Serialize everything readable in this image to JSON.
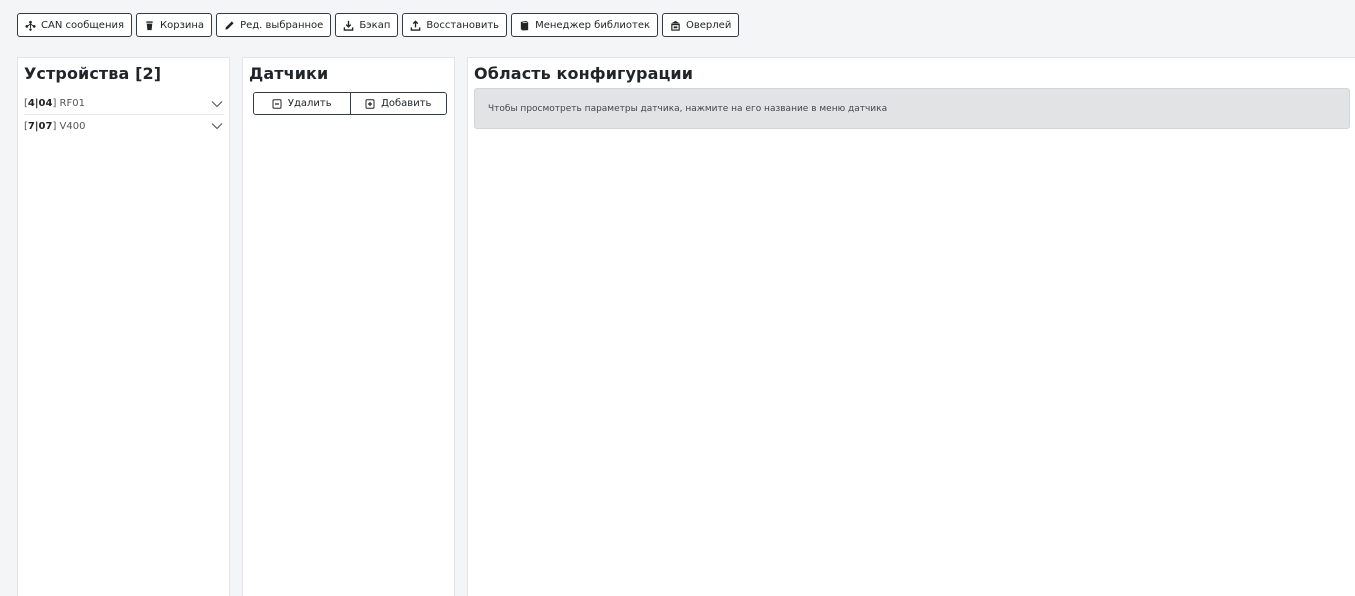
{
  "toolbar": {
    "buttons": [
      {
        "label": "CAN сообщения",
        "icon": "share-nodes-icon"
      },
      {
        "label": "Корзина",
        "icon": "trash-icon"
      },
      {
        "label": "Ред. выбранное",
        "icon": "pencil-icon"
      },
      {
        "label": "Бэкап",
        "icon": "download-icon"
      },
      {
        "label": "Восстановить",
        "icon": "upload-icon"
      },
      {
        "label": "Менеджер библиотек",
        "icon": "book-icon"
      },
      {
        "label": "Оверлей",
        "icon": "overlay-icon"
      }
    ]
  },
  "devices": {
    "title": "Устройства [2]",
    "items": [
      {
        "id_bold": "4|04",
        "name": "RF01"
      },
      {
        "id_bold": "7|07",
        "name": "V400"
      }
    ]
  },
  "sensors": {
    "title": "Датчики",
    "delete_label": "Удалить",
    "add_label": "Добавить"
  },
  "config": {
    "title": "Область конфигурации",
    "hint": "Чтобы просмотреть параметры датчика, нажмите на его название в меню датчика"
  },
  "colors": {
    "page_bg": "#f4f5f7",
    "panel_bg": "#ffffff",
    "button_border": "#343a40",
    "info_bg": "#e2e3e5",
    "info_text": "#41464b"
  }
}
